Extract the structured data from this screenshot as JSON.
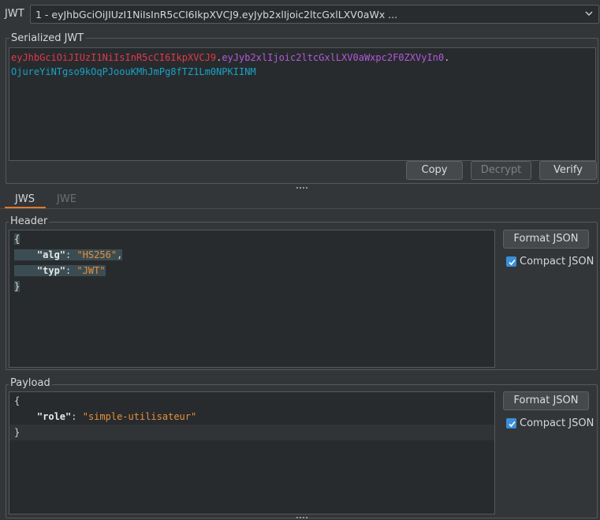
{
  "top": {
    "label": "JWT",
    "selected": "1 - eyJhbGciOiJIUzI1NiIsInR5cCI6IkpXVCJ9.eyJyb2xlIjoic2ltcGxlLXV0aWx ..."
  },
  "serialized": {
    "legend": "Serialized JWT",
    "header_part": "eyJhbGciOiJIUzI1NiIsInR5cCI6IkpXVCJ9",
    "payload_part": "eyJyb2xlIjoic2ltcGxlLXV0aWxpc2F0ZXVyIn0",
    "signature_part": "OjureYiNTgso9kOqPJoouKMhJmPg8fTZ1Lm0NPKIINM",
    "dot": ".",
    "buttons": {
      "copy": "Copy",
      "decrypt": "Decrypt",
      "verify": "Verify"
    }
  },
  "tabs": {
    "jws": "JWS",
    "jwe": "JWE"
  },
  "header": {
    "legend": "Header",
    "format_button": "Format JSON",
    "compact_label": "Compact JSON",
    "open_brace": "{",
    "close_brace": "}",
    "alg_key": "\"alg\"",
    "alg_value": "\"HS256\"",
    "typ_key": "\"typ\"",
    "typ_value": "\"JWT\"",
    "colon": ": ",
    "comma": ","
  },
  "payload": {
    "legend": "Payload",
    "format_button": "Format JSON",
    "compact_label": "Compact JSON",
    "open_brace": "{",
    "close_brace": "}",
    "role_key": "\"role\"",
    "role_value": "\"simple-utilisateur\"",
    "colon": ": "
  },
  "colors": {
    "jwt_header": "#e03a4a",
    "jwt_payload": "#b25ad9",
    "jwt_signature": "#17a3c6",
    "json_string": "#e88f3b",
    "tab_accent": "#e07a2e",
    "checkbox": "#3a8fd8"
  },
  "icons": {
    "select_arrow": "chevron-down-icon",
    "check": "check-icon"
  }
}
